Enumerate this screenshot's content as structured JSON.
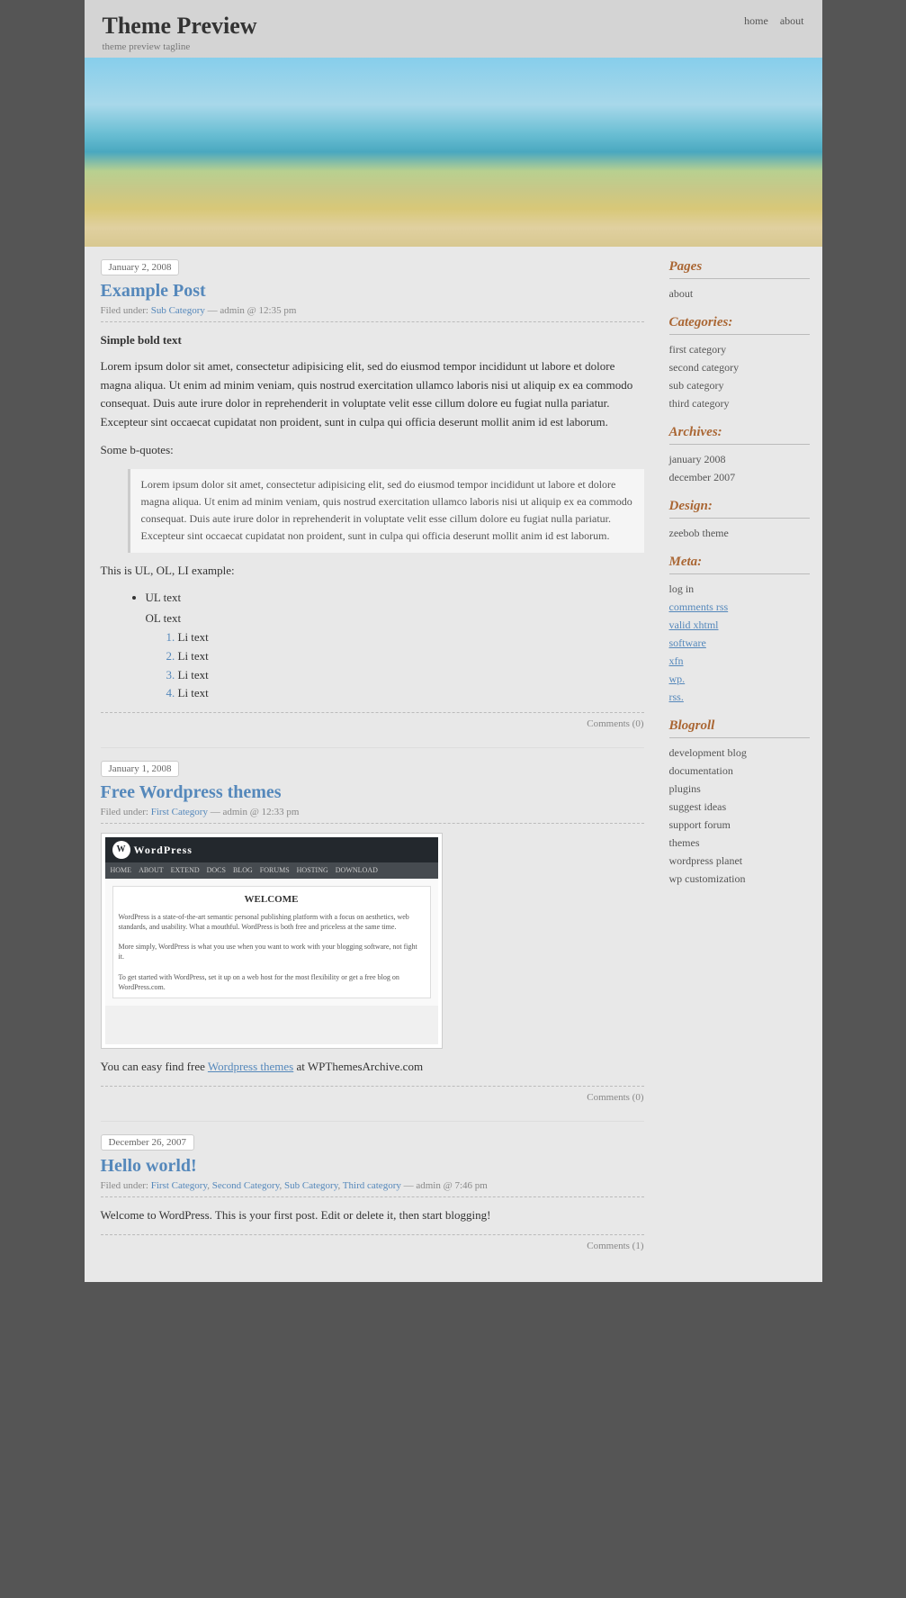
{
  "header": {
    "title": "Theme Preview",
    "tagline": "theme preview tagline",
    "nav": {
      "home": "home",
      "about": "about"
    }
  },
  "posts": [
    {
      "id": "post1",
      "date": "January 2, 2008",
      "title": "Example Post",
      "meta": "Filed under: Sub Category — admin @ 12:35 pm",
      "meta_category": "Sub Category",
      "meta_author": "admin @ 12:35 pm",
      "bold_text": "Simple bold text",
      "body_para": "Lorem ipsum dolor sit amet, consectetur adipisicing elit, sed do eiusmod tempor incididunt ut labore et dolore magna aliqua. Ut enim ad minim veniam, quis nostrud exercitation ullamco laboris nisi ut aliquip ex ea commodo consequat. Duis aute irure dolor in reprehenderit in voluptate velit esse cillum dolore eu fugiat nulla pariatur. Excepteur sint occaecat cupidatat non proident, sunt in culpa qui officia deserunt mollit anim id est laborum.",
      "bquote_intro": "Some b-quotes:",
      "blockquote": "Lorem ipsum dolor sit amet, consectetur adipisicing elit, sed do eiusmod tempor incididunt ut labore et dolore magna aliqua. Ut enim ad minim veniam, quis nostrud exercitation ullamco laboris nisi ut aliquip ex ea commodo consequat. Duis aute irure dolor in reprehenderit in voluptate velit esse cillum dolore eu fugiat nulla pariatur. Excepteur sint occaecat cupidatat non proident, sunt in culpa qui officia deserunt mollit anim id est laborum.",
      "list_intro": "This is UL, OL, LI example:",
      "ul_item": "UL text",
      "ol_label": "OL text",
      "li_items": [
        "Li text",
        "Li text",
        "Li text",
        "Li text"
      ],
      "comments": "Comments (0)"
    },
    {
      "id": "post2",
      "date": "January 1, 2008",
      "title": "Free Wordpress themes",
      "meta": "Filed under: First Category — admin @ 12:33 pm",
      "meta_category": "First Category",
      "meta_author": "admin @ 12:33 pm",
      "body_text1": "You can easy find free ",
      "body_link": "Wordpress themes",
      "body_text2": " at WPThemesArchive.com",
      "comments": "Comments (0)"
    },
    {
      "id": "post3",
      "date": "December 26, 2007",
      "title": "Hello world!",
      "meta": "Filed under: First Category, Second Category, Sub Category, Third category — admin @ 7:46 pm",
      "meta_category1": "First Category",
      "meta_category2": "Second Category",
      "meta_category3": "Sub Category",
      "meta_category4": "Third category",
      "meta_author": "admin @ 7:46 pm",
      "body_para": "Welcome to WordPress. This is your first post. Edit or delete it, then start blogging!",
      "comments": "Comments (1)"
    }
  ],
  "sidebar": {
    "pages": {
      "title": "Pages",
      "items": [
        {
          "label": "about",
          "href": "#"
        }
      ]
    },
    "categories": {
      "title": "Categories:",
      "items": [
        {
          "label": "first category",
          "href": "#"
        },
        {
          "label": "second category",
          "href": "#"
        },
        {
          "label": "sub category",
          "href": "#"
        },
        {
          "label": "third category",
          "href": "#"
        }
      ]
    },
    "archives": {
      "title": "Archives:",
      "items": [
        {
          "label": "january 2008",
          "href": "#"
        },
        {
          "label": "december 2007",
          "href": "#"
        }
      ]
    },
    "design": {
      "title": "Design:",
      "items": [
        {
          "label": "zeebob theme",
          "href": "#"
        }
      ]
    },
    "meta": {
      "title": "Meta:",
      "items": [
        {
          "label": "log in",
          "href": "#",
          "type": "normal"
        },
        {
          "label": "comments rss",
          "href": "#",
          "type": "rss"
        },
        {
          "label": "valid xhtml",
          "href": "#",
          "type": "rss"
        },
        {
          "label": "software",
          "href": "#",
          "type": "rss"
        },
        {
          "label": "xfn",
          "href": "#",
          "type": "rss"
        },
        {
          "label": "wp.",
          "href": "#",
          "type": "rss"
        },
        {
          "label": "rss.",
          "href": "#",
          "type": "rss"
        }
      ]
    },
    "blogroll": {
      "title": "Blogroll",
      "items": [
        {
          "label": "development blog",
          "href": "#"
        },
        {
          "label": "documentation",
          "href": "#"
        },
        {
          "label": "plugins",
          "href": "#"
        },
        {
          "label": "suggest ideas",
          "href": "#"
        },
        {
          "label": "support forum",
          "href": "#"
        },
        {
          "label": "themes",
          "href": "#"
        },
        {
          "label": "wordpress planet",
          "href": "#"
        },
        {
          "label": "wp customization",
          "href": "#"
        }
      ]
    }
  }
}
